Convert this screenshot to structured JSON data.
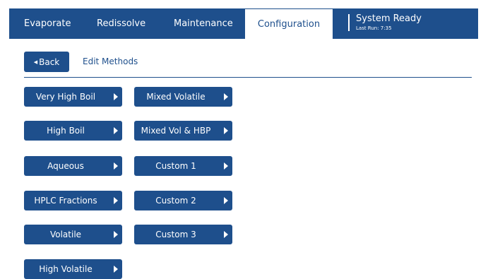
{
  "tabs": [
    {
      "label": "Evaporate"
    },
    {
      "label": "Redissolve"
    },
    {
      "label": "Maintenance"
    },
    {
      "label": "Configuration"
    }
  ],
  "status": {
    "title": "System Ready",
    "last_run": "Last Run: 7:35"
  },
  "toolbar": {
    "back_label": "Back",
    "heading": "Edit Methods"
  },
  "methods_left": [
    "Very High Boil",
    "High Boil",
    "Aqueous",
    "HPLC Fractions",
    "Volatile",
    "High Volatile"
  ],
  "methods_right": [
    "Mixed Volatile",
    "Mixed Vol & HBP",
    "Custom 1",
    "Custom 2",
    "Custom 3"
  ],
  "colors": {
    "primary": "#1e4f8c",
    "background": "#ffffff"
  }
}
